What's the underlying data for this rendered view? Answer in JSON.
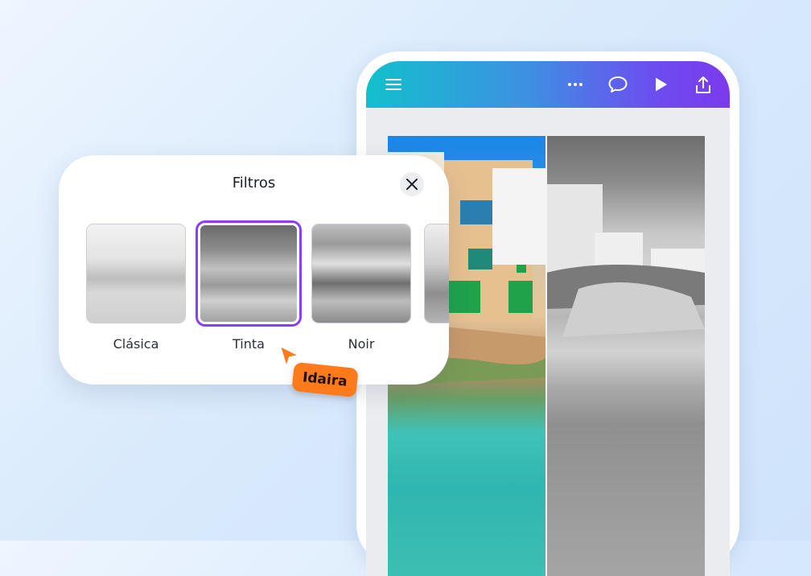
{
  "panel": {
    "title": "Filtros",
    "filters": [
      {
        "label": "Clásica",
        "selected": false
      },
      {
        "label": "Tinta",
        "selected": true
      },
      {
        "label": "Noir",
        "selected": false
      }
    ]
  },
  "collaborator": {
    "name": "Idaira"
  },
  "toolbar": {
    "icons": [
      "menu-icon",
      "more-icon",
      "comment-icon",
      "play-icon",
      "share-icon"
    ]
  },
  "colors": {
    "accent": "#8b3dff",
    "cursor": "#ff7a1a",
    "topbar_start": "#12c0cc",
    "topbar_end": "#7c3aed"
  }
}
